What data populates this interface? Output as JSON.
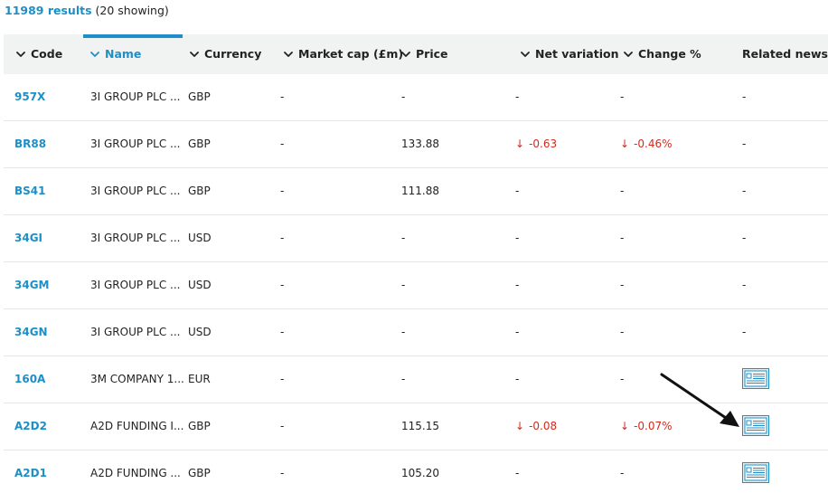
{
  "summary": {
    "results_count": "11989 results",
    "showing_text": "(20 showing)"
  },
  "colors": {
    "accent": "#1e8fc6",
    "negative": "#d32a1e",
    "header_bg": "#f1f2f2",
    "row_border": "#e4e6e7"
  },
  "columns": [
    {
      "key": "code",
      "label": "Code",
      "sortable": true,
      "active": false
    },
    {
      "key": "name",
      "label": "Name",
      "sortable": true,
      "active": true
    },
    {
      "key": "currency",
      "label": "Currency",
      "sortable": true,
      "active": false
    },
    {
      "key": "market_cap",
      "label": "Market cap (£m)",
      "sortable": true,
      "active": false
    },
    {
      "key": "price",
      "label": "Price",
      "sortable": true,
      "active": false
    },
    {
      "key": "net_variation",
      "label": "Net variation",
      "sortable": true,
      "active": false
    },
    {
      "key": "change_pct",
      "label": "Change %",
      "sortable": true,
      "active": false
    },
    {
      "key": "related_news",
      "label": "Related news",
      "sortable": false,
      "active": false
    }
  ],
  "rows": [
    {
      "code": "957X",
      "name": "3I GROUP PLC ...",
      "currency": "GBP",
      "market_cap": "-",
      "price": "-",
      "net_variation": "-",
      "net_variation_negative": false,
      "change_pct": "-",
      "change_negative": false,
      "related_news": "-",
      "has_news": false
    },
    {
      "code": "BR88",
      "name": "3I GROUP PLC ...",
      "currency": "GBP",
      "market_cap": "-",
      "price": "133.88",
      "net_variation": "-0.63",
      "net_variation_negative": true,
      "change_pct": "-0.46%",
      "change_negative": true,
      "related_news": "-",
      "has_news": false
    },
    {
      "code": "BS41",
      "name": "3I GROUP PLC ...",
      "currency": "GBP",
      "market_cap": "-",
      "price": "111.88",
      "net_variation": "-",
      "net_variation_negative": false,
      "change_pct": "-",
      "change_negative": false,
      "related_news": "-",
      "has_news": false
    },
    {
      "code": "34GI",
      "name": "3I GROUP PLC ...",
      "currency": "USD",
      "market_cap": "-",
      "price": "-",
      "net_variation": "-",
      "net_variation_negative": false,
      "change_pct": "-",
      "change_negative": false,
      "related_news": "-",
      "has_news": false
    },
    {
      "code": "34GM",
      "name": "3I GROUP PLC ...",
      "currency": "USD",
      "market_cap": "-",
      "price": "-",
      "net_variation": "-",
      "net_variation_negative": false,
      "change_pct": "-",
      "change_negative": false,
      "related_news": "-",
      "has_news": false
    },
    {
      "code": "34GN",
      "name": "3I GROUP PLC ...",
      "currency": "USD",
      "market_cap": "-",
      "price": "-",
      "net_variation": "-",
      "net_variation_negative": false,
      "change_pct": "-",
      "change_negative": false,
      "related_news": "-",
      "has_news": false
    },
    {
      "code": "160A",
      "name": "3M COMPANY 1...",
      "currency": "EUR",
      "market_cap": "-",
      "price": "-",
      "net_variation": "-",
      "net_variation_negative": false,
      "change_pct": "-",
      "change_negative": false,
      "related_news": "",
      "has_news": true
    },
    {
      "code": "A2D2",
      "name": "A2D FUNDING I...",
      "currency": "GBP",
      "market_cap": "-",
      "price": "115.15",
      "net_variation": "-0.08",
      "net_variation_negative": true,
      "change_pct": "-0.07%",
      "change_negative": true,
      "related_news": "",
      "has_news": true
    },
    {
      "code": "A2D1",
      "name": "A2D FUNDING ...",
      "currency": "GBP",
      "market_cap": "-",
      "price": "105.20",
      "net_variation": "-",
      "net_variation_negative": false,
      "change_pct": "-",
      "change_negative": false,
      "related_news": "",
      "has_news": true
    }
  ],
  "icons": {
    "sort": "chevron-down-icon",
    "news": "news-icon",
    "down_arrow": "↓"
  }
}
